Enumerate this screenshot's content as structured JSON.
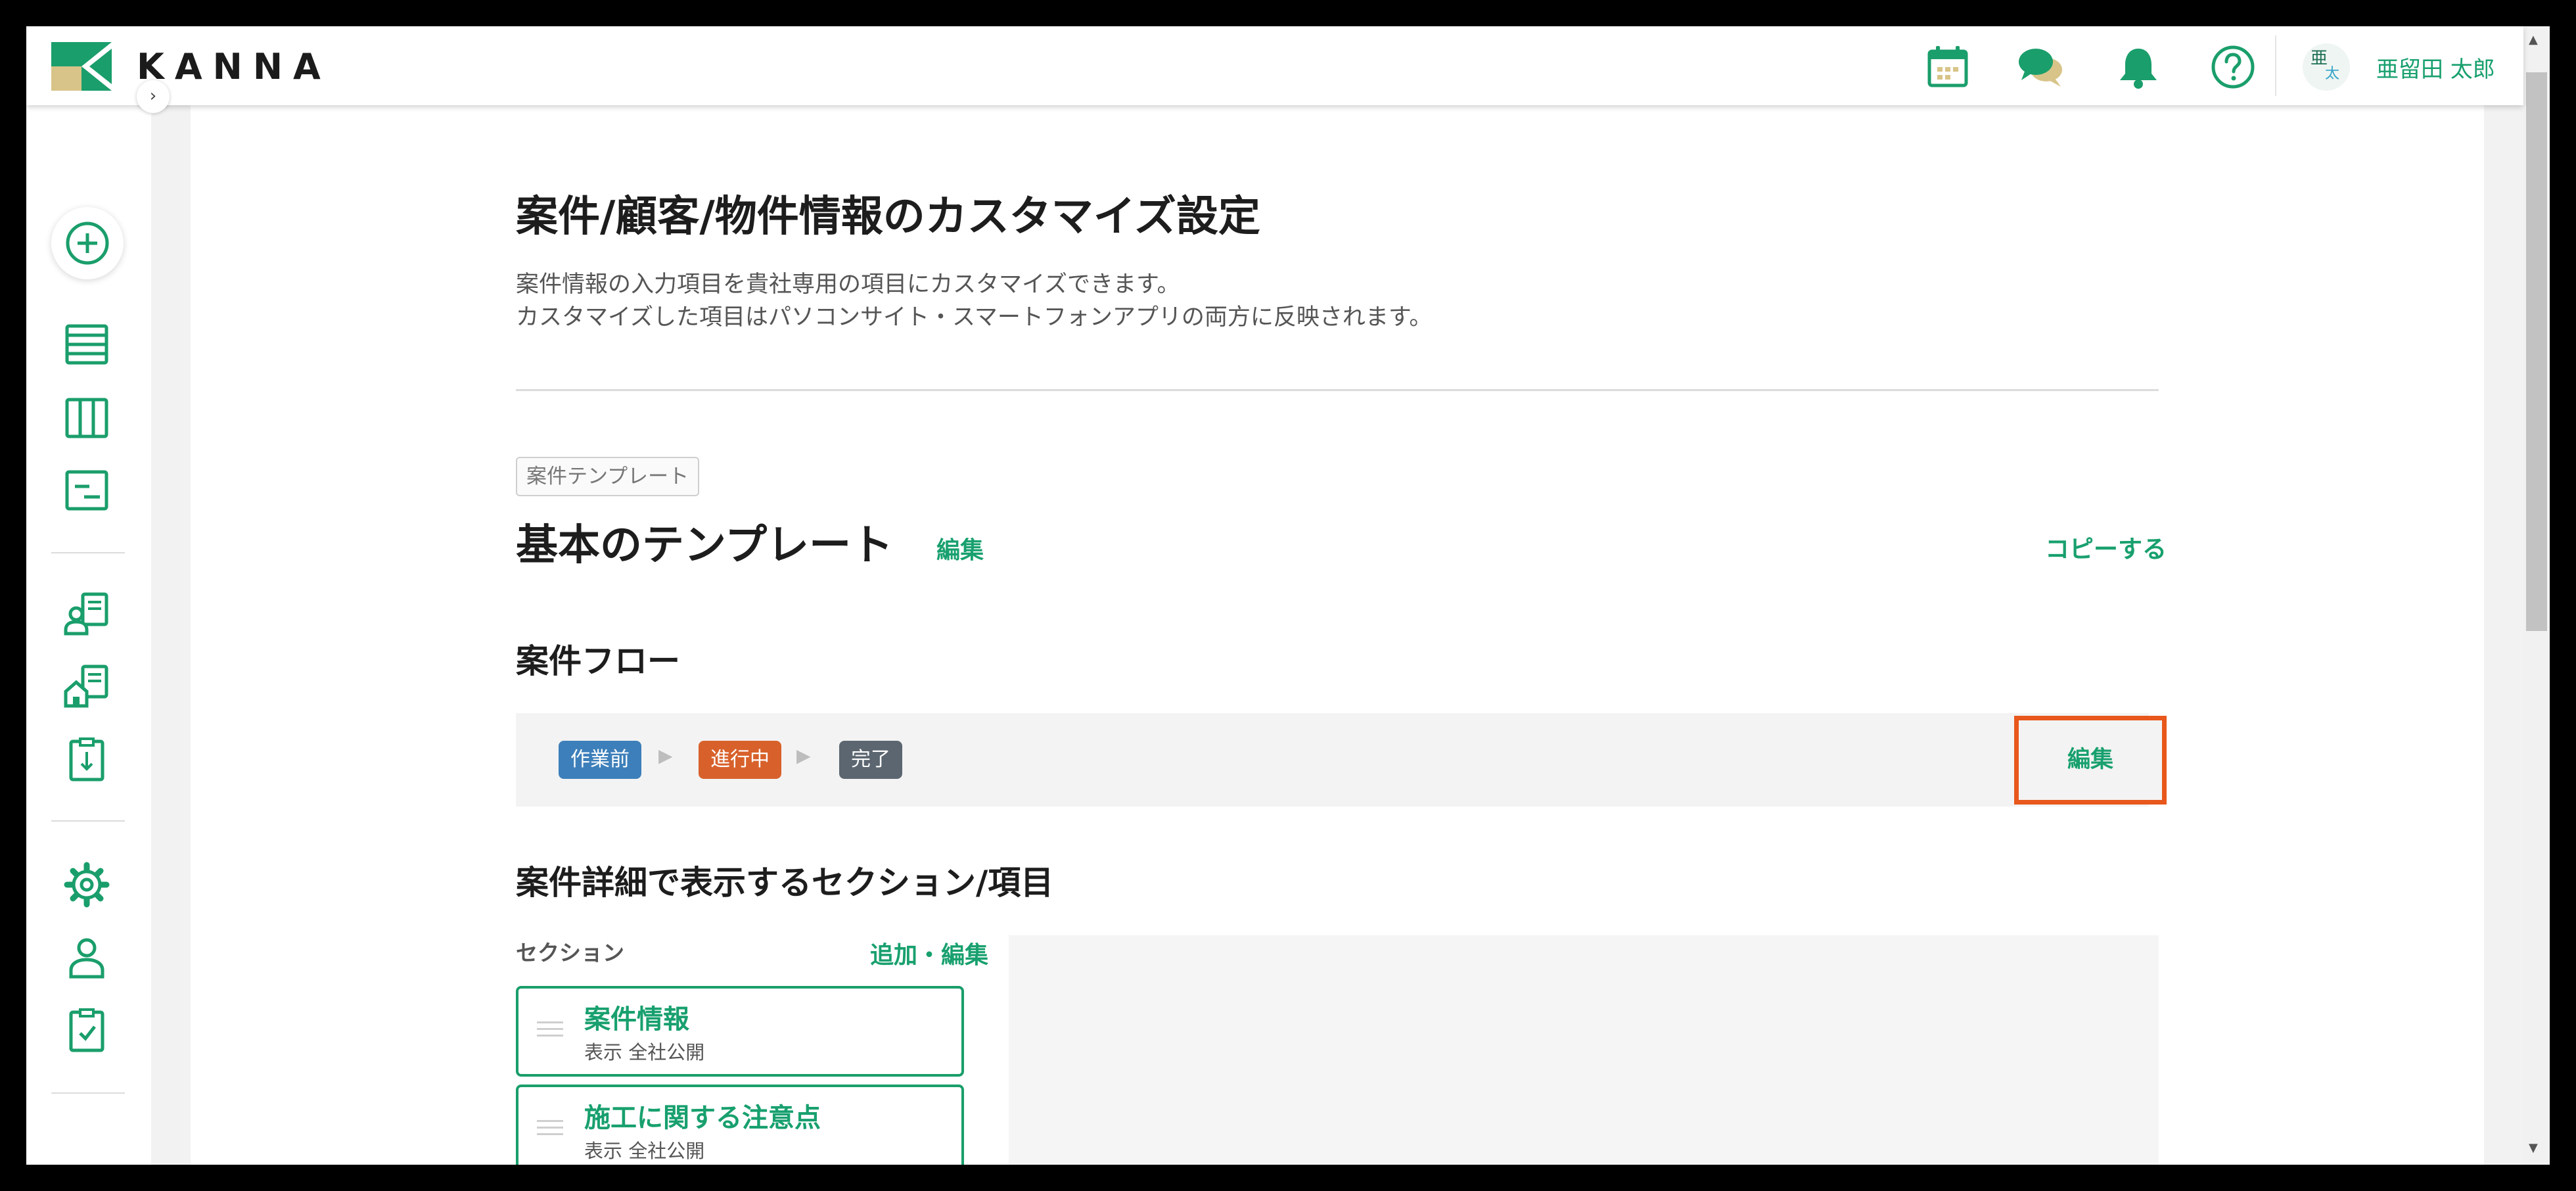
{
  "header": {
    "logo_text": "KANNA",
    "icons": [
      "calendar-icon",
      "chat-icon",
      "bell-icon",
      "help-icon"
    ],
    "user": {
      "avatar_top": "亜",
      "avatar_bottom": "太",
      "name": "亜留田 太郎"
    }
  },
  "sidebar": {
    "toggle": "›",
    "items": [
      "add-icon",
      "list-icon",
      "board-icon",
      "schedule-icon",
      "customer-icon",
      "property-icon",
      "import-icon",
      "settings-icon",
      "user-icon",
      "checklist-icon"
    ]
  },
  "page": {
    "title": "案件/顧客/物件情報のカスタマイズ設定",
    "desc1": "案件情報の入力項目を貴社専用の項目にカスタマイズできます。",
    "desc2": "カスタマイズした項目はパソコンサイト・スマートフォンアプリの両方に反映されます。"
  },
  "template": {
    "badge": "案件テンプレート",
    "name": "基本のテンプレート",
    "edit": "編集",
    "copy": "コピーする"
  },
  "flow": {
    "title": "案件フロー",
    "stages": [
      {
        "label": "作業前",
        "color": "#3d7fba"
      },
      {
        "label": "進行中",
        "color": "#d8612b"
      },
      {
        "label": "完了",
        "color": "#5b6670"
      }
    ],
    "arrow": "▶",
    "edit": "編集",
    "highlight_color": "#e8571b"
  },
  "details": {
    "title": "案件詳細で表示するセクション/項目",
    "section_label": "セクション",
    "add_edit": "追加・編集",
    "sections": [
      {
        "name": "案件情報",
        "meta": "表示  全社公開"
      },
      {
        "name": "施工に関する注意点",
        "meta": "表示  全社公開"
      }
    ]
  },
  "colors": {
    "accent": "#18a06e",
    "text": "#1d1d1d"
  }
}
